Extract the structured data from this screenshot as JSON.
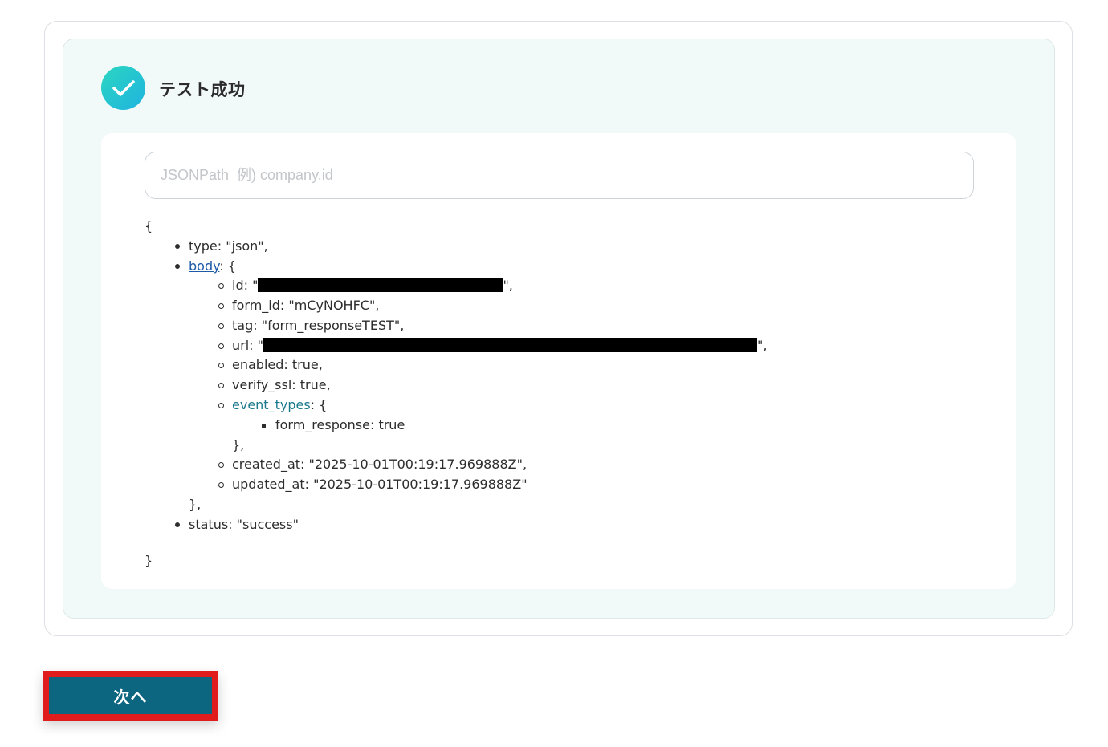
{
  "status": {
    "title": "テスト成功",
    "icon": "check-icon"
  },
  "search": {
    "placeholder": "JSONPath  例) company.id",
    "value": ""
  },
  "json": {
    "open_brace": "{",
    "close_brace": "}",
    "type_line": "type: \"json\",",
    "body_key": "body",
    "body_suffix": ": {",
    "id_prefix": "id: \"",
    "id_suffix": "\",",
    "form_id_line": "form_id: \"mCyNOHFC\",",
    "tag_line": "tag: \"form_responseTEST\",",
    "url_prefix": "url: \"",
    "url_suffix": "\",",
    "enabled_line": "enabled: true,",
    "verify_ssl_line": "verify_ssl: true,",
    "event_types_key": "event_types",
    "event_types_suffix": ": {",
    "form_response_line": "form_response: true",
    "event_types_close": "},",
    "created_at_line": "created_at: \"2025-10-01T00:19:17.969888Z\",",
    "updated_at_line": "updated_at: \"2025-10-01T00:19:17.969888Z\"",
    "body_close": "},",
    "status_line": "status: \"success\""
  },
  "actions": {
    "next_label": "次へ"
  }
}
